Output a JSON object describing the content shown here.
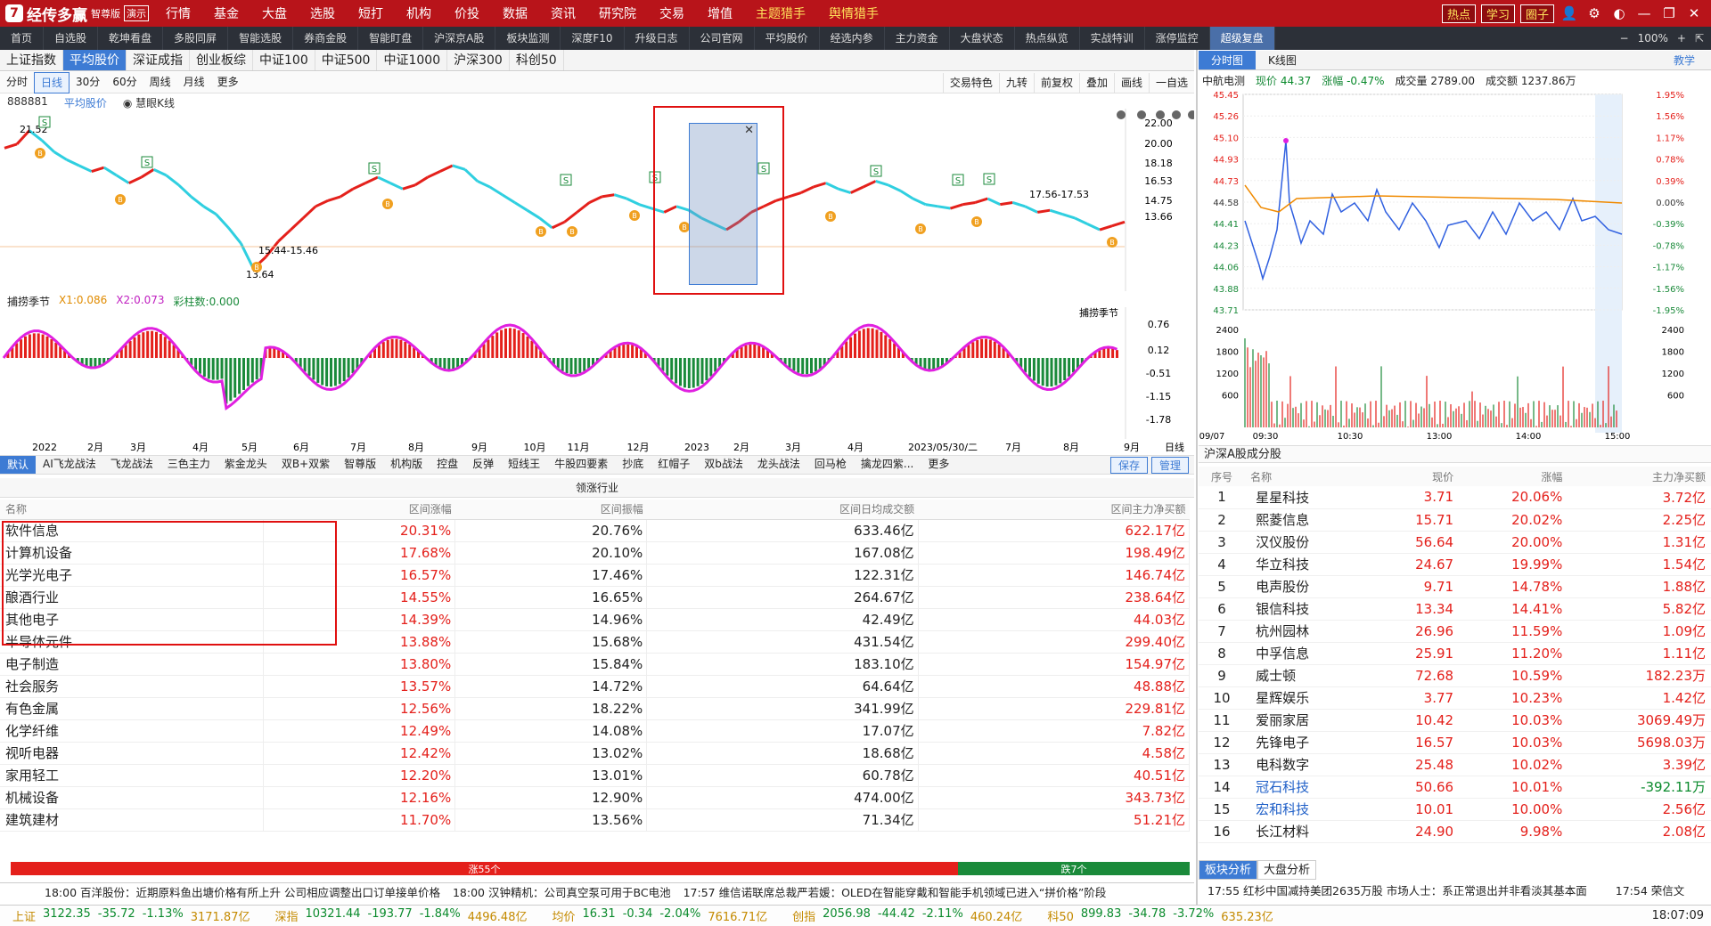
{
  "app": {
    "logo_mark": "7",
    "title": "经传多赢",
    "edition": "智尊版",
    "demo": "演示"
  },
  "menu": [
    "行情",
    "基金",
    "大盘",
    "选股",
    "短打",
    "机构",
    "价投",
    "数据",
    "资讯",
    "研究院",
    "交易",
    "增值",
    "主题猎手",
    "舆情猎手"
  ],
  "title_buttons": [
    "热点",
    "学习",
    "圈子"
  ],
  "title_icons": [
    "user-icon",
    "gear-icon",
    "skin-icon",
    "minimize-icon",
    "restore-icon",
    "close-icon"
  ],
  "tabs": [
    "首页",
    "自选股",
    "乾坤看盘",
    "多股同屏",
    "智能选股",
    "券商金股",
    "智能盯盘",
    "沪深京A股",
    "板块监测",
    "深度F10",
    "升级日志",
    "公司官网",
    "平均股价",
    "经选内参",
    "主力资金",
    "大盘状态",
    "热点纵览",
    "实战特训",
    "涨停监控",
    "超级复盘"
  ],
  "tab_right": {
    "zoom": "100%"
  },
  "index_tabs": [
    "上证指数",
    "平均股价",
    "深证成指",
    "创业板综",
    "中证100",
    "中证500",
    "中证1000",
    "沪深300",
    "科创50"
  ],
  "periods": [
    "分时",
    "日线",
    "30分",
    "60分",
    "周线",
    "月线",
    "更多"
  ],
  "period_right": [
    "交易特色",
    "九转",
    "前复权",
    "叠加",
    "画线",
    "一自选"
  ],
  "chart_info": {
    "code": "888881",
    "name": "平均股价",
    "mode": "慧眼K线"
  },
  "price_axis": [
    "22.00",
    "20.00",
    "18.18",
    "16.53",
    "14.75",
    "13.66"
  ],
  "annotations": {
    "high": "21.52",
    "low": "13.64",
    "range1": "15.44-15.46",
    "range2": "17.56-17.53"
  },
  "sub_info": {
    "name": "捕捞季节",
    "x1": "X1:0.086",
    "x2": "X2:0.073",
    "col": "彩柱数:0.000"
  },
  "sub_axis": [
    "0.76",
    "0.12",
    "-0.51",
    "-1.15",
    "-1.78"
  ],
  "sub_right_label": "捕捞季节",
  "x_axis": [
    "2022",
    "2月",
    "3月",
    "4月",
    "5月",
    "6月",
    "7月",
    "8月",
    "9月",
    "10月",
    "11月",
    "12月",
    "2023",
    "2月",
    "3月",
    "4月",
    "2023/05/30/二",
    "7月",
    "8月",
    "9月",
    "日线"
  ],
  "indicators": [
    "默认",
    "AI飞龙战法",
    "飞龙战法",
    "三色主力",
    "紫金龙头",
    "双B+双紫",
    "智尊版",
    "机构版",
    "控盘",
    "反弹",
    "短线王",
    "牛股四要素",
    "抄底",
    "红帽子",
    "双b战法",
    "龙头战法",
    "回马枪",
    "擒龙四紫...",
    "更多"
  ],
  "indicator_buttons": [
    "保存",
    "管理"
  ],
  "lead_table": {
    "title": "领涨行业",
    "headers": [
      "名称",
      "区间涨幅",
      "区间振幅",
      "区间日均成交额",
      "区间主力净买额"
    ],
    "rows": [
      [
        "软件信息",
        "20.31%",
        "20.76%",
        "633.46亿",
        "622.17亿"
      ],
      [
        "计算机设备",
        "17.68%",
        "20.10%",
        "167.08亿",
        "198.49亿"
      ],
      [
        "光学光电子",
        "16.57%",
        "17.46%",
        "122.31亿",
        "146.74亿"
      ],
      [
        "酿酒行业",
        "14.55%",
        "16.65%",
        "264.67亿",
        "238.64亿"
      ],
      [
        "其他电子",
        "14.39%",
        "14.96%",
        "42.49亿",
        "44.03亿"
      ],
      [
        "半导体元件",
        "13.88%",
        "15.68%",
        "431.54亿",
        "299.40亿"
      ],
      [
        "电子制造",
        "13.80%",
        "15.84%",
        "183.10亿",
        "154.97亿"
      ],
      [
        "社会服务",
        "13.57%",
        "14.72%",
        "64.64亿",
        "48.88亿"
      ],
      [
        "有色金属",
        "12.56%",
        "18.22%",
        "341.99亿",
        "229.81亿"
      ],
      [
        "化学纤维",
        "12.49%",
        "14.08%",
        "17.07亿",
        "7.82亿"
      ],
      [
        "视听电器",
        "12.42%",
        "13.02%",
        "18.68亿",
        "4.58亿"
      ],
      [
        "家用轻工",
        "12.20%",
        "13.01%",
        "60.78亿",
        "40.51亿"
      ],
      [
        "机械设备",
        "12.16%",
        "12.90%",
        "474.00亿",
        "343.73亿"
      ],
      [
        "建筑建材",
        "11.70%",
        "13.56%",
        "71.34亿",
        "51.21亿"
      ]
    ]
  },
  "updown": {
    "up_label": "涨55个",
    "down_label": "跌7个",
    "up": 55,
    "down": 7
  },
  "news": [
    "18:00 百洋股份：近期原料鱼出塘价格有所上升 公司相应调整出口订单接单价格",
    "18:00 汉钟精机：公司真空泵可用于BC电池",
    "17:57 维信诺联席总裁严若媛：OLED在智能穿戴和智能手机领域已进入“拼价格”阶段"
  ],
  "right_news": "17:55 红杉中国减持美团2635万股 市场人士：系正常退出并非看淡其基本面",
  "right_news_time": "17:54 荣信文",
  "index_bar": [
    {
      "name": "上证",
      "value": "3122.35",
      "chg": "-35.72",
      "pct": "-1.13%",
      "amt": "3171.87亿"
    },
    {
      "name": "深指",
      "value": "10321.44",
      "chg": "-193.77",
      "pct": "-1.84%",
      "amt": "4496.48亿"
    },
    {
      "name": "均价",
      "value": "16.31",
      "chg": "-0.34",
      "pct": "-2.04%",
      "amt": "7616.71亿"
    },
    {
      "name": "创指",
      "value": "2056.98",
      "chg": "-44.42",
      "pct": "-2.11%",
      "amt": "460.24亿"
    },
    {
      "name": "科50",
      "value": "899.83",
      "chg": "-34.78",
      "pct": "-3.72%",
      "amt": "635.23亿"
    }
  ],
  "clock": "18:07:09",
  "right_tabs": [
    "分时图",
    "K线图"
  ],
  "right_help": "教学",
  "stock": {
    "name": "中航电测",
    "price_label": "现价",
    "price": "44.37",
    "chg_label": "涨幅",
    "chg": "-0.47%",
    "vol_label": "成交量",
    "vol": "2789.00",
    "amt_label": "成交额",
    "amt": "1237.86万"
  },
  "min_left_axis": [
    "45.45",
    "45.26",
    "45.10",
    "44.93",
    "44.73",
    "44.58",
    "44.41",
    "44.23",
    "44.06",
    "43.88",
    "43.71"
  ],
  "min_right_axis": [
    "1.95%",
    "1.56%",
    "1.17%",
    "0.78%",
    "0.39%",
    "0.00%",
    "-0.39%",
    "-0.78%",
    "-1.17%",
    "-1.56%",
    "-1.95%"
  ],
  "vol_axis": [
    "2400",
    "1800",
    "1200",
    "600"
  ],
  "min_time_axis": [
    "09/07",
    "09:30",
    "10:30",
    "13:00",
    "14:00",
    "15:00"
  ],
  "hs_title": "沪深A股成分股",
  "hs_headers": [
    "序号",
    "名称",
    "现价",
    "涨幅",
    "主力净买额"
  ],
  "hs_rows": [
    [
      "1",
      "星星科技",
      "3.71",
      "20.06%",
      "3.72亿"
    ],
    [
      "2",
      "熙菱信息",
      "15.71",
      "20.02%",
      "2.25亿"
    ],
    [
      "3",
      "汉仪股份",
      "56.64",
      "20.00%",
      "1.31亿"
    ],
    [
      "4",
      "华立科技",
      "24.67",
      "19.99%",
      "1.54亿"
    ],
    [
      "5",
      "电声股份",
      "9.71",
      "14.78%",
      "1.88亿"
    ],
    [
      "6",
      "银信科技",
      "13.34",
      "14.41%",
      "5.82亿"
    ],
    [
      "7",
      "杭州园林",
      "26.96",
      "11.59%",
      "1.09亿"
    ],
    [
      "8",
      "中孚信息",
      "25.91",
      "11.20%",
      "1.11亿"
    ],
    [
      "9",
      "威士顿",
      "72.68",
      "10.59%",
      "182.23万"
    ],
    [
      "10",
      "星辉娱乐",
      "3.77",
      "10.23%",
      "1.42亿"
    ],
    [
      "11",
      "爱丽家居",
      "10.42",
      "10.03%",
      "3069.49万"
    ],
    [
      "12",
      "先锋电子",
      "16.57",
      "10.03%",
      "5698.03万"
    ],
    [
      "13",
      "电科数字",
      "25.48",
      "10.02%",
      "3.39亿"
    ],
    [
      "14",
      "冠石科技",
      "50.66",
      "10.01%",
      "-392.11万"
    ],
    [
      "15",
      "宏和科技",
      "10.01",
      "10.00%",
      "2.56亿"
    ],
    [
      "16",
      "长江材料",
      "24.90",
      "9.98%",
      "2.08亿"
    ]
  ],
  "right_bottom_tabs": [
    "板块分析",
    "大盘分析"
  ]
}
